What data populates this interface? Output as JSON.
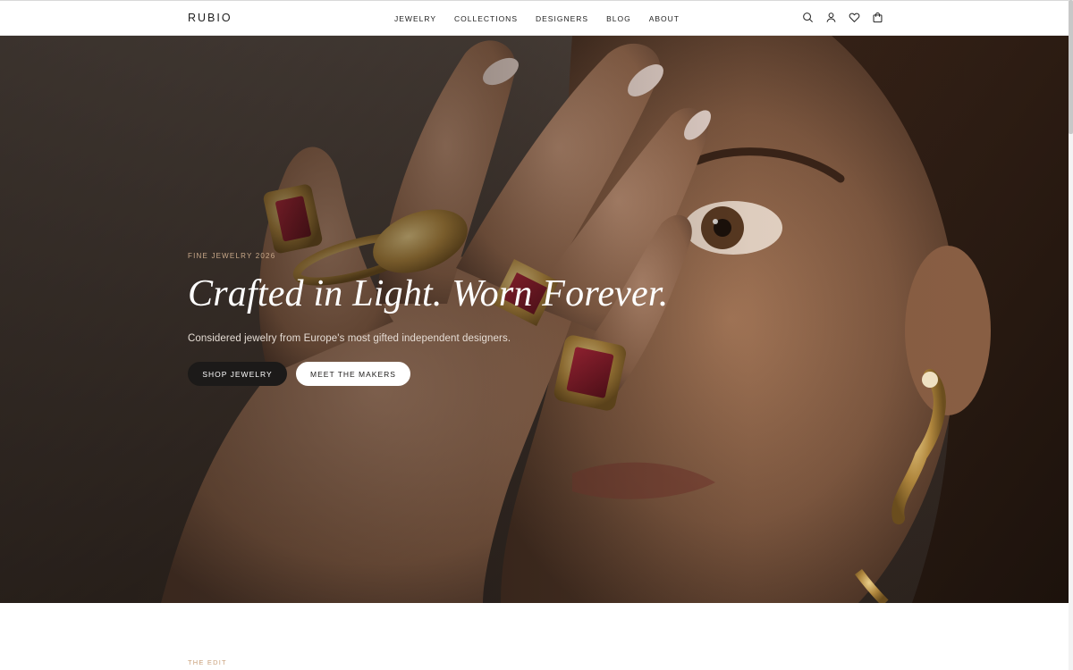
{
  "brand": {
    "logo": "RUBIO"
  },
  "nav": {
    "items": [
      "JEWELRY",
      "COLLECTIONS",
      "DESIGNERS",
      "BLOG",
      "ABOUT"
    ]
  },
  "header_icons": [
    "search-icon",
    "account-icon",
    "wishlist-heart-icon",
    "shopping-bag-icon"
  ],
  "hero": {
    "eyebrow": "FINE JEWELRY 2026",
    "title": "Crafted in Light. Worn Forever.",
    "subtitle": "Considered jewelry from Europe's most gifted independent designers.",
    "primary_cta": "SHOP JEWELRY",
    "secondary_cta": "MEET THE MAKERS"
  },
  "edit_section": {
    "label": "THE EDIT"
  },
  "colors": {
    "accent_gold": "#c9a98a",
    "dark_button": "#1c1a19",
    "white": "#ffffff"
  }
}
